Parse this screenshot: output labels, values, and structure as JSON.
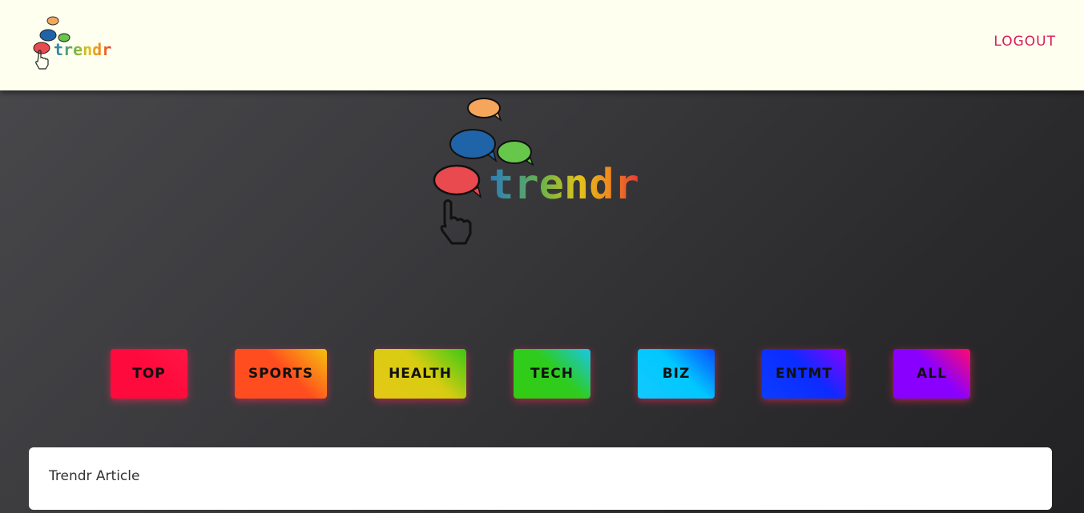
{
  "navbar": {
    "logo_text": "trendr",
    "logout_label": "LOGOUT"
  },
  "hero": {
    "logo_text": "trendr"
  },
  "categories": [
    {
      "label": "TOP",
      "gradient": [
        "#ff0a3c",
        "#ff0a3c",
        "#ff1744"
      ]
    },
    {
      "label": "SPORTS",
      "gradient": [
        "#ff4d1f",
        "#ff4d1f",
        "#f4c20d"
      ]
    },
    {
      "label": "HEALTH",
      "gradient": [
        "#e5c816",
        "#d8cc12",
        "#39c814"
      ]
    },
    {
      "label": "TECH",
      "gradient": [
        "#33cc14",
        "#2fcc1e",
        "#19c6e8"
      ]
    },
    {
      "label": "BIZ",
      "gradient": [
        "#14c8ff",
        "#00c8ff",
        "#0a4dff"
      ]
    },
    {
      "label": "ENTMT",
      "gradient": [
        "#0a3dff",
        "#0d2bff",
        "#8a00ff"
      ]
    },
    {
      "label": "ALL",
      "gradient": [
        "#8a00ff",
        "#8a00ff",
        "#ff0a6c"
      ]
    }
  ],
  "article": {
    "title": "Trendr Article"
  },
  "colors": {
    "navbar_bg": "#fffff0",
    "logout": "#d81b5a",
    "bubble_orange": "#f5a65b",
    "bubble_blue": "#1f64a8",
    "bubble_green": "#66c74a",
    "bubble_red": "#e84a4f"
  },
  "icons": [
    "speech-bubble-icon",
    "pointer-hand-icon"
  ]
}
